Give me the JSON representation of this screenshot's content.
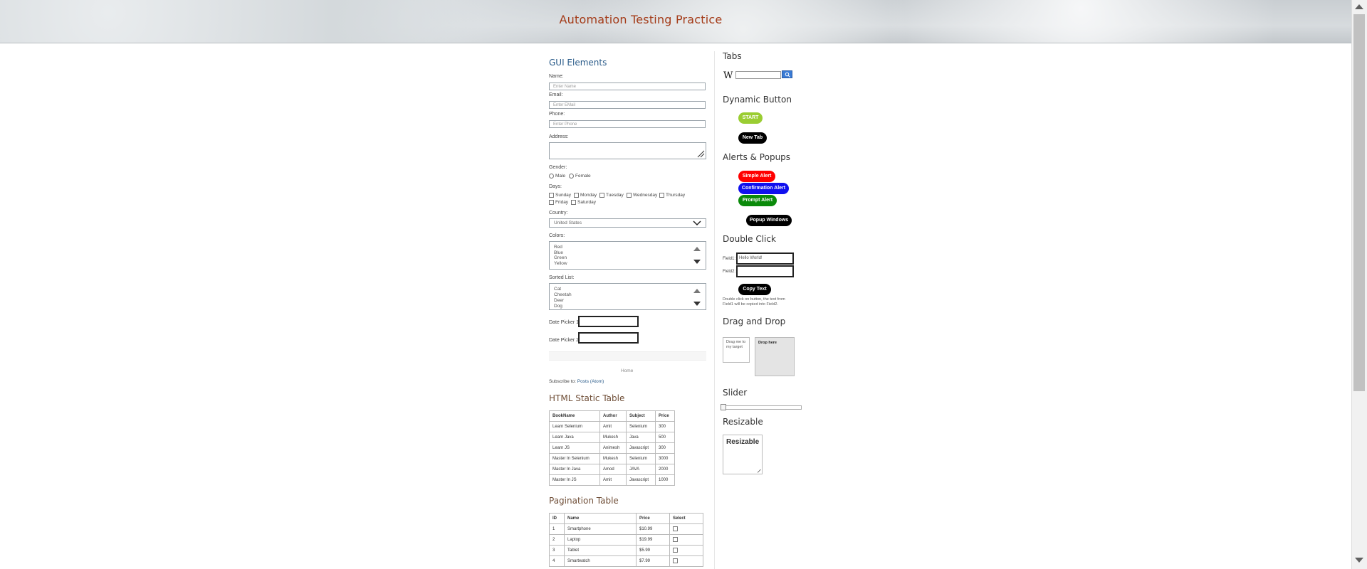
{
  "header": {
    "title": "Automation Testing Practice"
  },
  "gui": {
    "title": "GUI Elements",
    "name_label": "Name:",
    "name_placeholder": "Enter Name",
    "email_label": "Email:",
    "email_placeholder": "Enter EMail",
    "phone_label": "Phone:",
    "phone_placeholder": "Enter Phone",
    "address_label": "Address:",
    "gender_label": "Gender:",
    "male": "Male",
    "female": "Female",
    "days_label": "Days:",
    "days": [
      "Sunday",
      "Monday",
      "Tuesday",
      "Wednesday",
      "Thursday",
      "Friday",
      "Saturday"
    ],
    "country_label": "Country:",
    "country_value": "United States",
    "colors_label": "Colors:",
    "colors": [
      "Red",
      "Blue",
      "Green",
      "Yellow"
    ],
    "sorted_label": "Sorted List:",
    "sorted": [
      "Cat",
      "Cheetah",
      "Deer",
      "Dog"
    ],
    "date1_label": "Date Picker 1:",
    "date2_label": "Date Picker 2:",
    "home_link": "Home",
    "subscribe_prefix": "Subscribe to:",
    "subscribe_link": "Posts (Atom)"
  },
  "static_table": {
    "title": "HTML Static Table",
    "headers": [
      "BookName",
      "Author",
      "Subject",
      "Price"
    ],
    "rows": [
      [
        "Learn Selenium",
        "Amit",
        "Selenium",
        "300"
      ],
      [
        "Learn Java",
        "Mukesh",
        "Java",
        "500"
      ],
      [
        "Learn JS",
        "Animesh",
        "Javascript",
        "300"
      ],
      [
        "Master In Selenium",
        "Mukesh",
        "Selenium",
        "3000"
      ],
      [
        "Master In Java",
        "Amod",
        "JAVA",
        "2000"
      ],
      [
        "Master In JS",
        "Amit",
        "Javascript",
        "1000"
      ]
    ]
  },
  "pagination_table": {
    "title": "Pagination Table",
    "headers": [
      "ID",
      "Name",
      "Price",
      "Select"
    ],
    "rows": [
      [
        "1",
        "Smartphone",
        "$10.99"
      ],
      [
        "2",
        "Laptop",
        "$19.99"
      ],
      [
        "3",
        "Tablet",
        "$5.99"
      ],
      [
        "4",
        "Smartwatch",
        "$7.99"
      ]
    ]
  },
  "right": {
    "tabs_title": "Tabs",
    "wiki_logo": "W",
    "dynamic_title": "Dynamic Button",
    "start_label": "START",
    "newtab_label": "New Tab",
    "alerts_title": "Alerts & Popups",
    "simple_alert": "Simple Alert",
    "confirm_alert": "Confirmation Alert",
    "prompt_alert": "Prompt Alert",
    "popup_windows": "Popup Windows",
    "dblclick_title": "Double Click",
    "field1_label": "Field1:",
    "field1_value": "Hello World!",
    "field2_label": "Field2:",
    "copy_text": "Copy Text",
    "dbl_hint": "Double click on button, the text from Field1 will be copied into Field2.",
    "drag_title": "Drag and Drop",
    "drag_text": "Drag me to my target",
    "drop_text": "Drop here",
    "slider_title": "Slider",
    "resizable_title": "Resizable",
    "resizable_label": "Resizable"
  },
  "colors": {
    "start": "#9acd32",
    "simple": "#ff0000",
    "confirm": "#1010ee",
    "prompt": "#0a8a0a",
    "black": "#000000"
  }
}
